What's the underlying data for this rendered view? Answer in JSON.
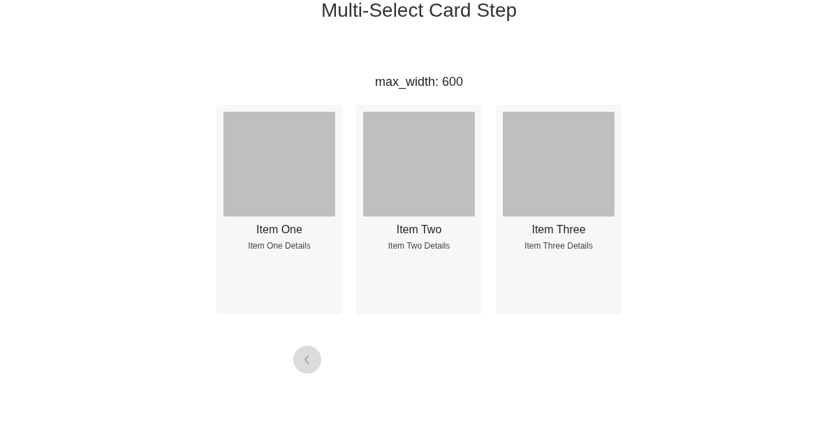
{
  "title": "Multi-Select Card Step",
  "subtitle": "max_width: 600",
  "cards": [
    {
      "title": "Item One",
      "details": "Item One Details",
      "selected": false
    },
    {
      "title": "Item Two",
      "details": "Item Two Details",
      "selected": false
    },
    {
      "title": "Item Three",
      "details": "Item Three Details",
      "selected": false
    }
  ],
  "back_button": {
    "kind": "chevron"
  }
}
